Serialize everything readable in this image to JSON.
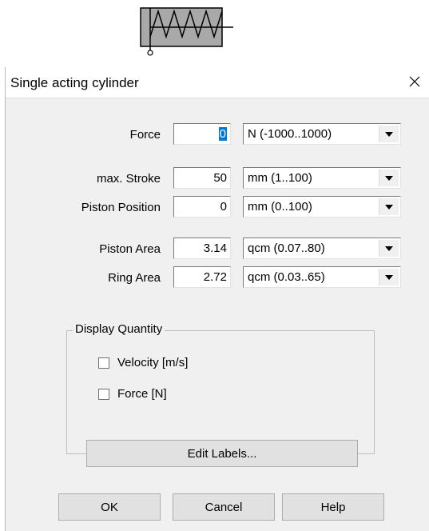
{
  "dialog": {
    "title": "Single acting cylinder"
  },
  "fields": [
    {
      "label": "Force",
      "value": "0",
      "unit": "N  (-1000..1000)"
    },
    {
      "label": "max. Stroke",
      "value": "50",
      "unit": "mm  (1..100)"
    },
    {
      "label": "Piston Position",
      "value": "0",
      "unit": "mm  (0..100)"
    },
    {
      "label": "Piston Area",
      "value": "3.14",
      "unit": "qcm  (0.07..80)"
    },
    {
      "label": "Ring Area",
      "value": "2.72",
      "unit": "qcm  (0.03..65)"
    }
  ],
  "display_quantity": {
    "title": "Display Quantity",
    "options": [
      {
        "label": "Velocity [m/s]",
        "checked": false
      },
      {
        "label": "Force [N]",
        "checked": false
      }
    ]
  },
  "buttons": {
    "edit_labels": "Edit Labels...",
    "ok": "OK",
    "cancel": "Cancel",
    "help": "Help"
  },
  "icons": {
    "cylinder": "single-acting-cylinder-symbol",
    "close": "close-icon",
    "dropdown": "chevron-down-icon"
  }
}
